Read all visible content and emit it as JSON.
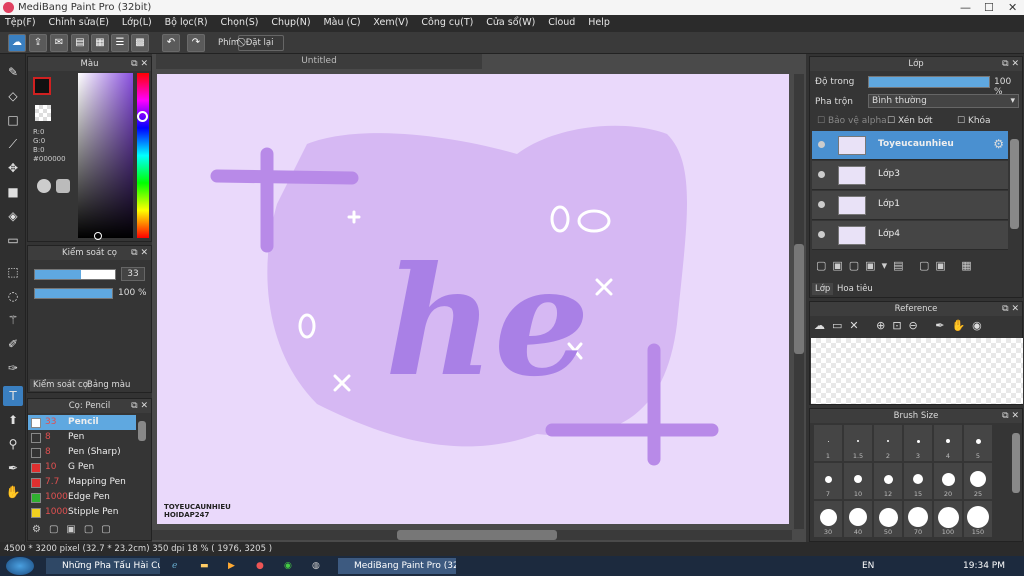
{
  "window": {
    "title": "MediBang Paint Pro (32bit)",
    "min": "—",
    "max": "☐",
    "close": "✕"
  },
  "menu": [
    "Tệp(F)",
    "Chỉnh sửa(E)",
    "Lớp(L)",
    "Bộ lọc(R)",
    "Chọn(S)",
    "Chụp(N)",
    "Màu (C)",
    "Xem(V)",
    "Công cụ(T)",
    "Cửa sổ(W)",
    "Cloud",
    "Help"
  ],
  "toolbar": {
    "phim": "Phím",
    "reset": "Đặt lại"
  },
  "canvas_tab": "Untitled",
  "color_panel": {
    "title": "Màu",
    "r": "R:0",
    "g": "G:0",
    "b": "B:0",
    "hex": "#000000"
  },
  "brush_control": {
    "title": "Kiểm soát cọ",
    "size": "33",
    "opacity": "100 %",
    "tab1": "Kiểm soát cọ",
    "tab2": "Bảng màu"
  },
  "brush_list": {
    "title": "Cọ: Pencil",
    "items": [
      {
        "size": "33",
        "name": "Pencil",
        "color": "#ffffff"
      },
      {
        "size": "8",
        "name": "Pen",
        "color": "#333333"
      },
      {
        "size": "8",
        "name": "Pen (Sharp)",
        "color": "#333333"
      },
      {
        "size": "10",
        "name": "G Pen",
        "color": "#e03030"
      },
      {
        "size": "7.7",
        "name": "Mapping Pen",
        "color": "#e03030"
      },
      {
        "size": "1000",
        "name": "Edge Pen",
        "color": "#30b030"
      },
      {
        "size": "1000",
        "name": "Stipple Pen",
        "color": "#f0d020"
      }
    ]
  },
  "layer_panel": {
    "title": "Lớp",
    "opacity_label": "Độ trong",
    "opacity": "100 %",
    "blend_label": "Pha trộn",
    "blend": "Bình thường",
    "protect": "Bảo vệ alpha",
    "clip": "Xén bớt",
    "lock": "Khóa",
    "layers": [
      "Toyeucaunhieu",
      "Lớp3",
      "Lớp1",
      "Lớp4"
    ],
    "tab1": "Lớp",
    "tab2": "Hoa tiêu"
  },
  "reference": {
    "title": "Reference"
  },
  "brush_size": {
    "title": "Brush Size",
    "sizes": [
      "1",
      "1.5",
      "2",
      "3",
      "4",
      "5",
      "7",
      "10",
      "12",
      "15",
      "20",
      "25",
      "30",
      "40",
      "50",
      "70",
      "100",
      "150"
    ]
  },
  "artwork": {
    "text": "he",
    "signature1": "TOYEUCAUNHIEU",
    "signature2": "HOIDAP247"
  },
  "status": {
    "text": "4500 * 3200 pixel   (32.7 * 23.2cm)   350 dpi   18 %   ( 1976, 3205 )"
  },
  "taskbar": {
    "tab1": "Những Pha Tấu Hài Cư...",
    "tab2": "MediBang Paint Pro (32...",
    "lang": "EN",
    "time": "19:34 PM"
  }
}
